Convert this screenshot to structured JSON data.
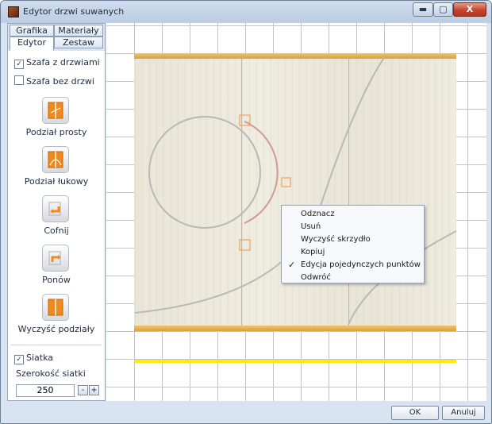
{
  "window": {
    "title": "Edytor drzwi suwanych",
    "minimize_glyph": "▬",
    "maximize_glyph": "▢",
    "close_glyph": "X"
  },
  "tabs": {
    "row1": [
      "Grafika",
      "Materiały"
    ],
    "row2": [
      "Edytor",
      "Zestaw"
    ],
    "active": "Edytor"
  },
  "options": {
    "with_doors_label": "Szafa z drzwiami",
    "with_doors_checked": true,
    "without_doors_label": "Szafa bez drzwi",
    "without_doors_checked": false
  },
  "tools": {
    "straight_split": "Podział prosty",
    "arc_split": "Podział łukowy",
    "undo": "Cofnij",
    "redo": "Ponów",
    "clear_splits": "Wyczyść podziały"
  },
  "grid": {
    "show_label": "Siatka",
    "show_checked": true,
    "width_label": "Szerokość siatki",
    "width_value": "250",
    "minus": "-",
    "plus": "+"
  },
  "context_menu": {
    "items": [
      "Odznacz",
      "Usuń",
      "Wyczyść skrzydło",
      "Kopiuj",
      "Edycja pojedynczych punktów",
      "Odwróć"
    ],
    "checked_index": 4,
    "check_glyph": "✓"
  },
  "buttons": {
    "ok": "OK",
    "cancel": "Anuluj"
  },
  "colors": {
    "rail": "#d8a240",
    "selection_marker": "#f0a060",
    "bottom_strip": "#ffec00"
  },
  "icons": {
    "app": "app-icon",
    "split-straight": "door-orange-icon",
    "split-arc": "door-orange-icon",
    "undo": "undo-arrow-icon",
    "redo": "redo-arrow-icon",
    "clear": "door-orange-icon"
  }
}
